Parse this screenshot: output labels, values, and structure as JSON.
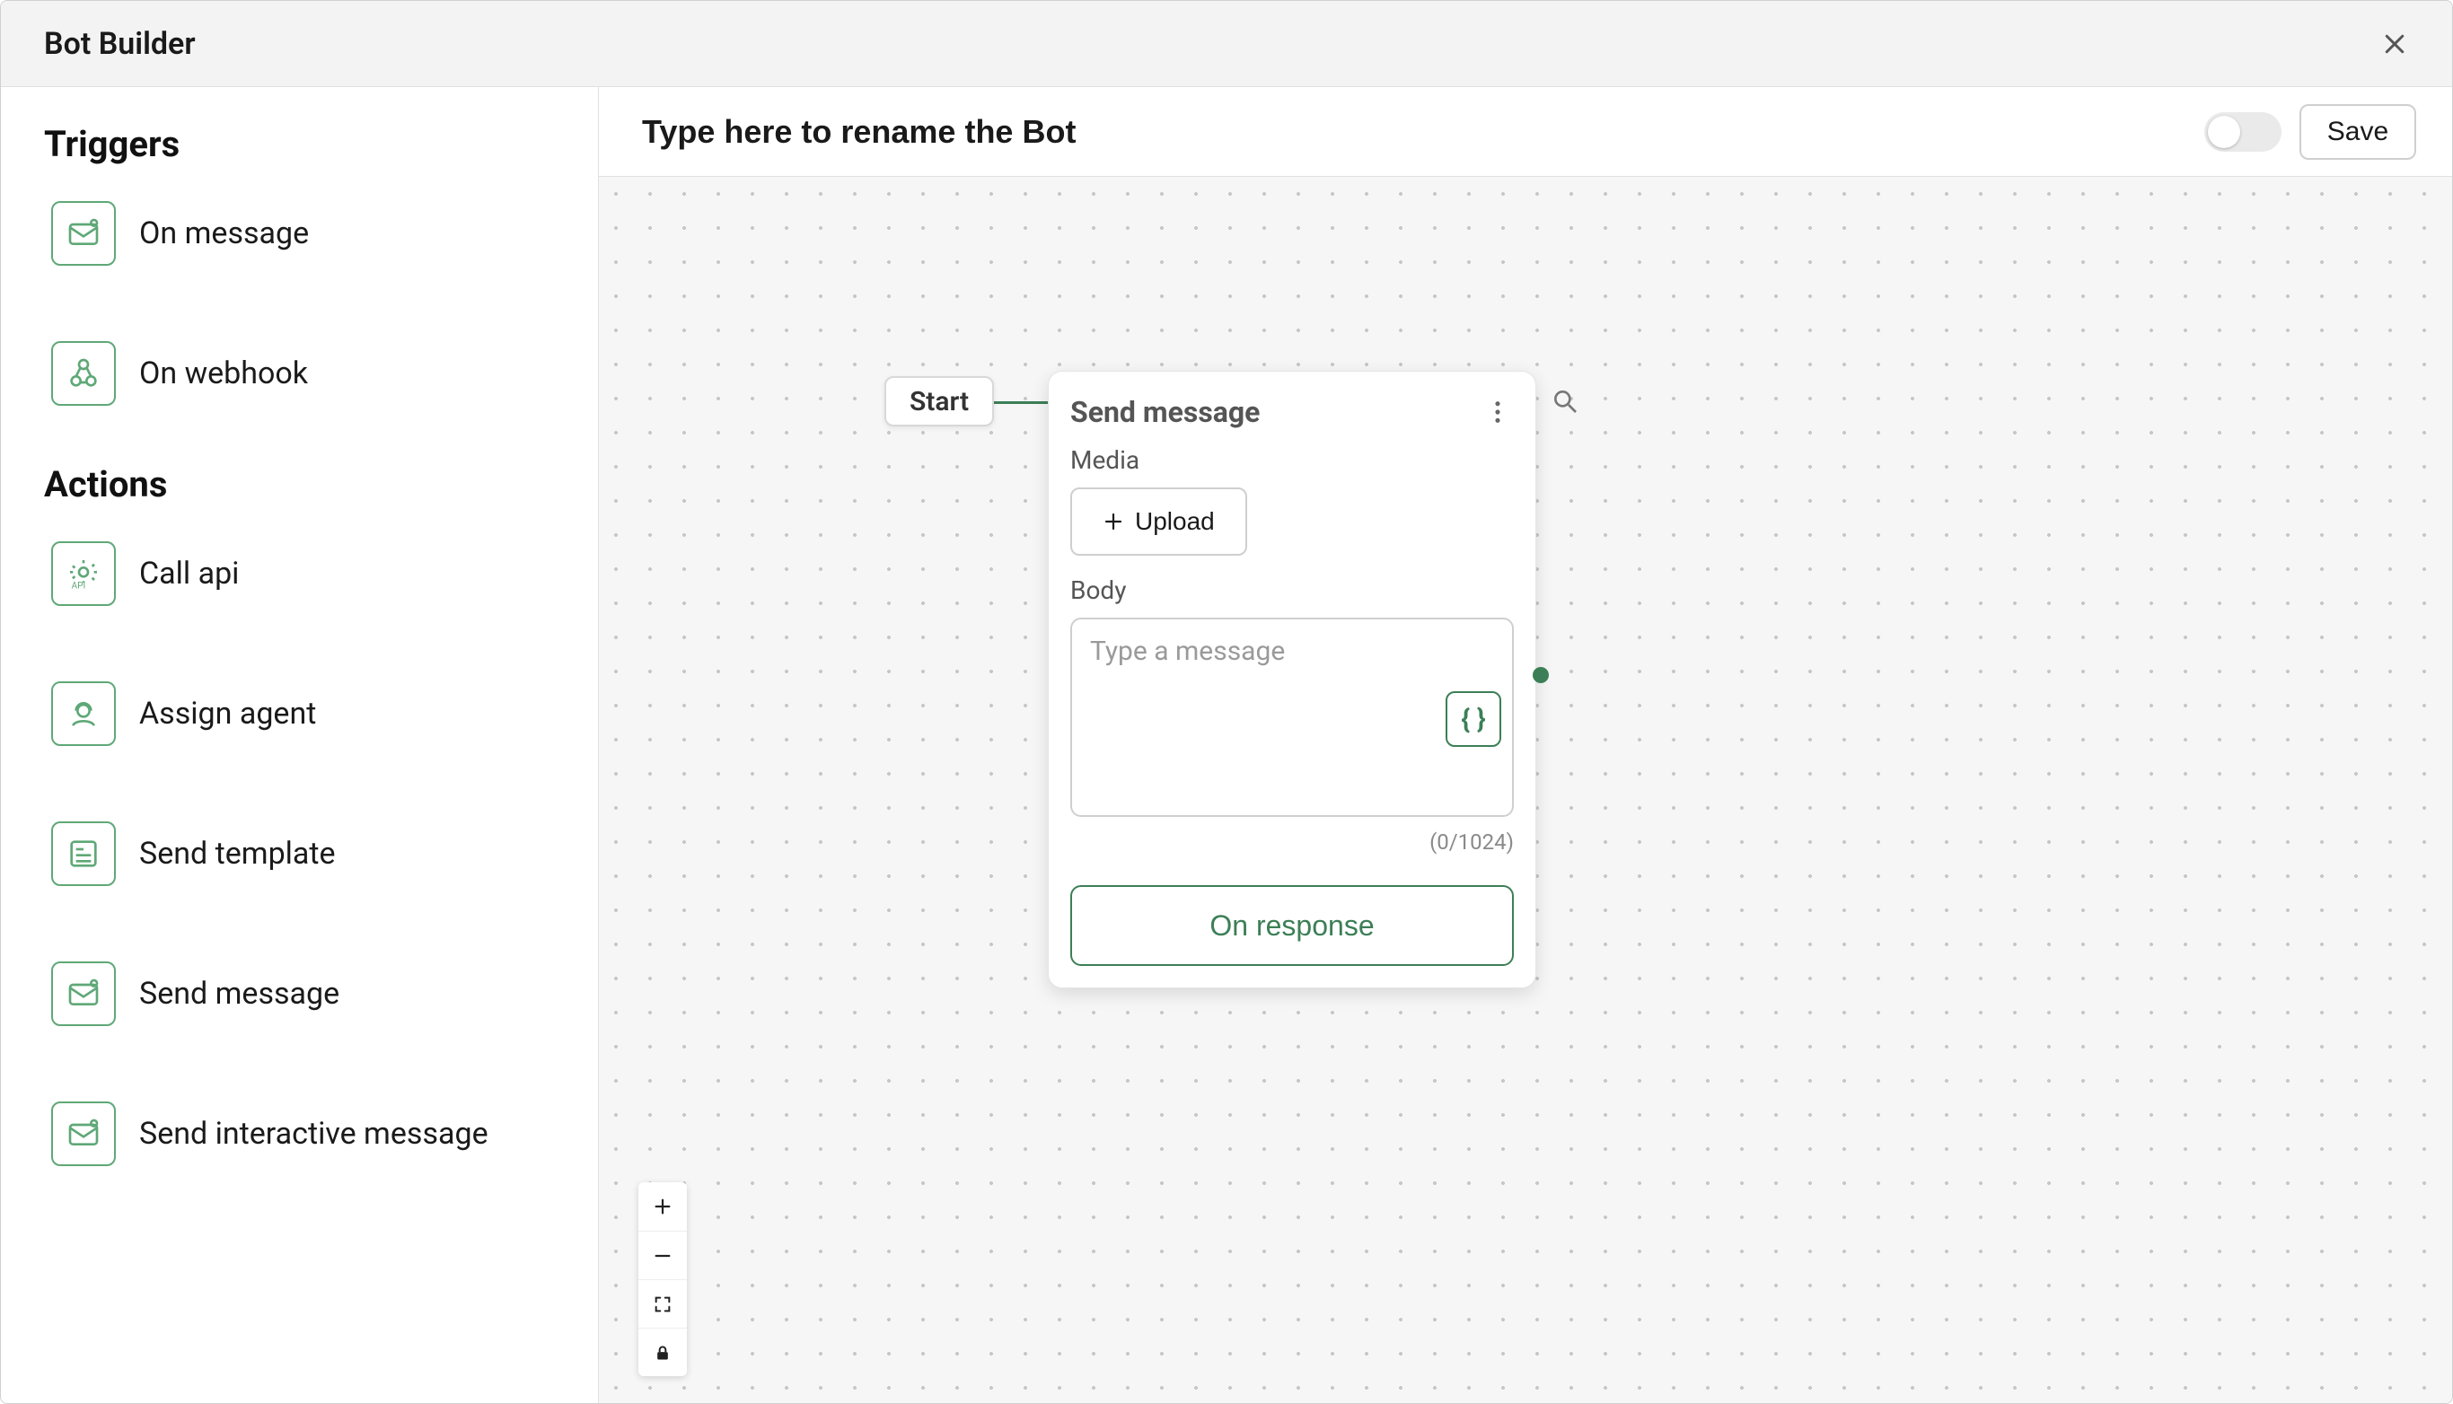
{
  "window": {
    "title": "Bot Builder"
  },
  "header": {
    "rename_placeholder": "Type here to rename the Bot",
    "save_label": "Save",
    "enabled_toggle": false
  },
  "sidebar": {
    "sections": [
      {
        "heading": "Triggers",
        "items": [
          {
            "id": "on-message",
            "label": "On message",
            "icon": "mail-trigger-icon"
          },
          {
            "id": "on-webhook",
            "label": "On webhook",
            "icon": "webhook-icon"
          }
        ]
      },
      {
        "heading": "Actions",
        "items": [
          {
            "id": "call-api",
            "label": "Call api",
            "icon": "api-gear-icon"
          },
          {
            "id": "assign-agent",
            "label": "Assign agent",
            "icon": "agent-icon"
          },
          {
            "id": "send-template",
            "label": "Send template",
            "icon": "template-icon"
          },
          {
            "id": "send-message",
            "label": "Send message",
            "icon": "send-message-icon"
          },
          {
            "id": "send-interactive-message",
            "label": "Send interactive message",
            "icon": "send-interactive-icon"
          }
        ]
      }
    ]
  },
  "canvas": {
    "start_label": "Start",
    "node": {
      "title": "Send message",
      "media_label": "Media",
      "upload_label": "Upload",
      "body_label": "Body",
      "body_placeholder": "Type a message",
      "body_value": "",
      "char_count": "(0/1024)",
      "variable_chip_label": "{ }",
      "on_response_label": "On response"
    }
  },
  "colors": {
    "accent_green": "#3c7f56",
    "accent_green_border": "#5fa877",
    "canvas_bg": "#f6f6f6"
  }
}
